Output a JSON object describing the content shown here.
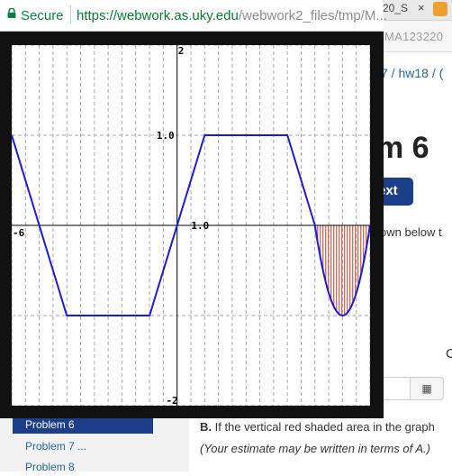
{
  "browser": {
    "secure_label": "Secure",
    "url_host": "https://webwork.as.uky.edu",
    "url_path": "/webwork2_files/tmp/M...",
    "bg_tab_title": "20_S",
    "bg_tab_close": "×",
    "bg_address_fragment": "MA123220"
  },
  "background_page": {
    "breadcrumb": "7 / hw18 / (",
    "heading": "m 6",
    "next_button": "ext",
    "paragraph_fragment": "own below t",
    "part_c_fragment": "C",
    "keypad_label": "▦",
    "sidebar_items": [
      "Problem 6",
      "Problem 7 ...",
      "Problem 8"
    ],
    "part_b_label": "B.",
    "part_b_text": " If the vertical red shaded area in the graph",
    "estimate_note": "(Your estimate may be written in terms of A.)"
  },
  "graph": {
    "tick_labels": {
      "y_top": "2",
      "y_one": "1.0",
      "x_left": "-6",
      "x_one": "1.0",
      "y_bottom": "-2"
    },
    "colors": {
      "curve": "#1a1ad6",
      "shade": "#c0392b",
      "grid": "#a8a8a8",
      "axis": "#000000"
    }
  },
  "chart_data": {
    "type": "line",
    "xlim": [
      -6,
      7
    ],
    "ylim": [
      -2,
      2
    ],
    "grid": true,
    "x": [
      -6,
      -5,
      -4,
      -3,
      -2,
      -1,
      0,
      1,
      2,
      3,
      4,
      5,
      5.5,
      6,
      6.5,
      7
    ],
    "series": [
      {
        "values": [
          1,
          0,
          -1,
          -1,
          -1,
          -1,
          0,
          1,
          1,
          1,
          1,
          0,
          -0.75,
          -1,
          -0.75,
          0
        ]
      }
    ],
    "shaded_region": {
      "x_from": 5,
      "x_to": 7,
      "pattern": "vertical red lines"
    }
  }
}
